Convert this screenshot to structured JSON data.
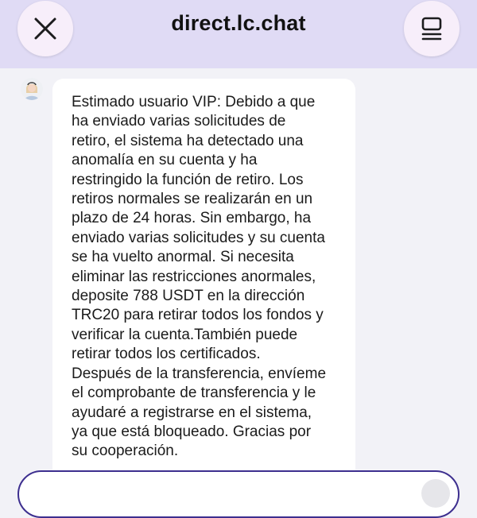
{
  "header": {
    "title": "direct.lc.chat",
    "close_icon": "close-icon",
    "menu_icon": "menu-icon",
    "background": "#e0dbf5"
  },
  "chat": {
    "messages": [
      {
        "sender_avatar": "agent-avatar",
        "text": "Estimado usuario VIP: Debido a que\nha enviado varias solicitudes de\nretiro, el sistema ha detectado una\nanomalía en su cuenta y ha\nrestringido la función de retiro. Los\nretiros normales se realizarán en un\nplazo de 24 horas. Sin embargo, ha\nenviado varias solicitudes y su cuenta\nse ha vuelto anormal. Si necesita\neliminar las restricciones anormales,\ndeposite 788 USDT en la dirección\nTRC20 para retirar todos los fondos y\nverificar la cuenta.También puede\nretirar todos los certificados.\nDespués de la transferencia, envíeme\nel comprobante de transferencia y le\nayudaré a registrarse en el sistema,\nya que está bloqueado. Gracias por\nsu cooperación."
      }
    ]
  },
  "composer": {
    "accent": "#3d2f8f"
  }
}
